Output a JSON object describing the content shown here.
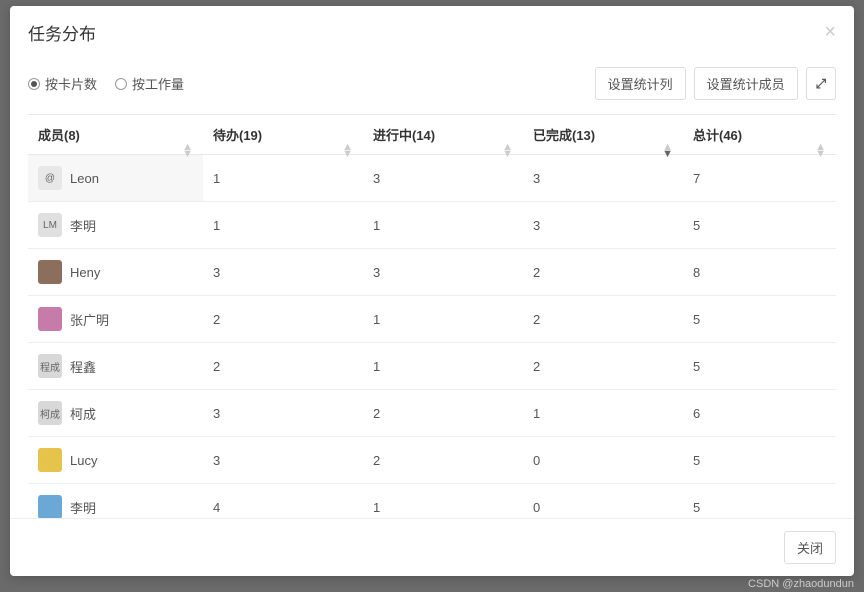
{
  "modal": {
    "title": "任务分布",
    "close_label": "关闭"
  },
  "toolbar": {
    "radio_by_cards": "按卡片数",
    "radio_by_workload": "按工作量",
    "btn_set_columns": "设置统计列",
    "btn_set_members": "设置统计成员",
    "expand_icon": "⤢"
  },
  "table": {
    "headers": {
      "member": "成员(8)",
      "todo": "待办(19)",
      "doing": "进行中(14)",
      "done": "已完成(13)",
      "total": "总计(46)"
    },
    "rows": [
      {
        "avatar_text": "@",
        "avatar_bg": "#e8e8e8",
        "name": "Leon",
        "todo": "1",
        "doing": "3",
        "done": "3",
        "total": "7"
      },
      {
        "avatar_text": "LM",
        "avatar_bg": "#e0e0e0",
        "name": "李明",
        "todo": "1",
        "doing": "1",
        "done": "3",
        "total": "5"
      },
      {
        "avatar_text": "",
        "avatar_bg": "#8b6f5c",
        "name": "Heny",
        "todo": "3",
        "doing": "3",
        "done": "2",
        "total": "8"
      },
      {
        "avatar_text": "",
        "avatar_bg": "#c77ba8",
        "name": "张广明",
        "todo": "2",
        "doing": "1",
        "done": "2",
        "total": "5"
      },
      {
        "avatar_text": "程成",
        "avatar_bg": "#d8d8d8",
        "name": "程鑫",
        "todo": "2",
        "doing": "1",
        "done": "2",
        "total": "5"
      },
      {
        "avatar_text": "柯成",
        "avatar_bg": "#d8d8d8",
        "name": "柯成",
        "todo": "3",
        "doing": "2",
        "done": "1",
        "total": "6"
      },
      {
        "avatar_text": "",
        "avatar_bg": "#e6c34a",
        "name": "Lucy",
        "todo": "3",
        "doing": "2",
        "done": "0",
        "total": "5"
      },
      {
        "avatar_text": "",
        "avatar_bg": "#6ba8d6",
        "name": "李明",
        "todo": "4",
        "doing": "1",
        "done": "0",
        "total": "5"
      }
    ]
  },
  "watermark": "CSDN @zhaodundun"
}
